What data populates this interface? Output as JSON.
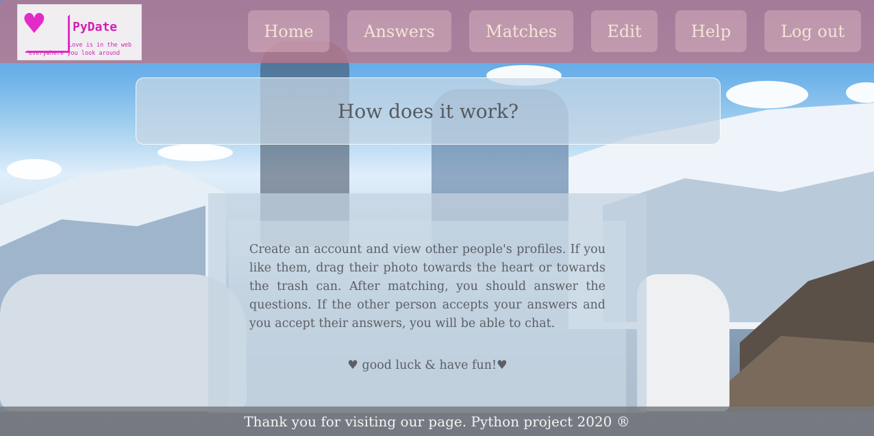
{
  "logo": {
    "name": "PyDate",
    "tagline_line1": "Love is in the web",
    "tagline_line2": "everywhere you look around"
  },
  "nav": {
    "home": "Home",
    "answers": "Answers",
    "matches": "Matches",
    "edit": "Edit",
    "help": "Help",
    "logout": "Log out"
  },
  "main": {
    "title": "How does it work?",
    "description": "Create an account and view other people's profiles. If you like them, drag their photo towards the heart or towards the trash can. After matching, you should answer the questions. If the other person accepts your answers and you accept their answers, you will be able to chat.",
    "wish": "♥ good luck & have fun!♥"
  },
  "footer": {
    "text": "Thank you for visiting our page. Python project 2020 ®"
  },
  "colors": {
    "header": "#b9788c",
    "logo_accent": "#e52bc7",
    "footer": "#78787c",
    "text": "#5b5f66"
  }
}
